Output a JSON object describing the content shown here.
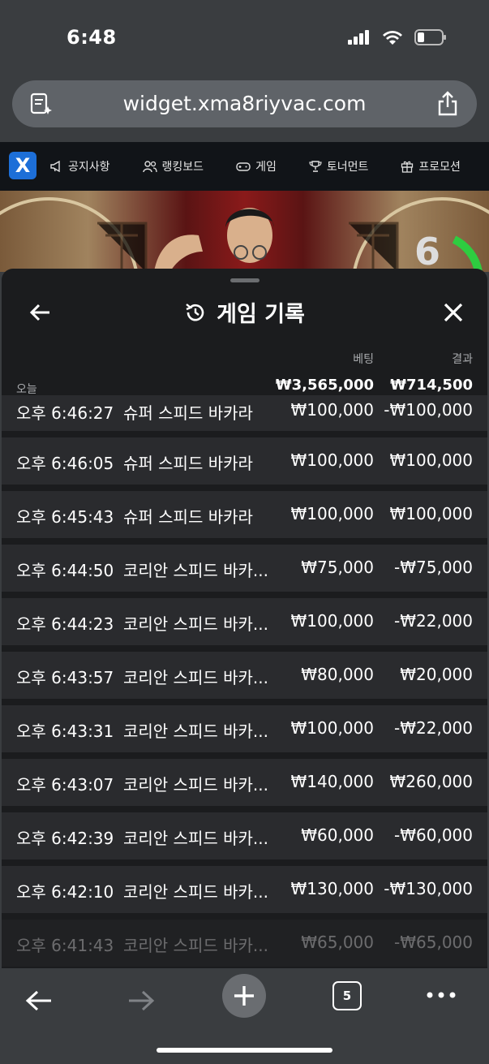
{
  "status_bar": {
    "time": "6:48"
  },
  "browser": {
    "url": "widget.xma8riyvac.com",
    "tab_count": "5"
  },
  "site_nav": {
    "logo": "X",
    "items": [
      {
        "label": "공지사항",
        "icon": "megaphone-icon"
      },
      {
        "label": "랭킹보드",
        "icon": "users-icon"
      },
      {
        "label": "게임",
        "icon": "gamepad-icon"
      },
      {
        "label": "토너먼트",
        "icon": "trophy-icon"
      },
      {
        "label": "프로모션",
        "icon": "gift-icon"
      }
    ]
  },
  "video": {
    "timer": "6"
  },
  "panel": {
    "title": "게임 기록",
    "columns": {
      "bet": "베팅",
      "result": "결과"
    },
    "summary": {
      "label": "오늘",
      "bet": "₩3,565,000",
      "result": "₩714,500"
    },
    "rows": [
      {
        "time": "오후 6:46:27",
        "game": "슈퍼 스피드 바카라",
        "bet": "₩100,000",
        "result": "-₩100,000"
      },
      {
        "time": "오후 6:46:05",
        "game": "슈퍼 스피드 바카라",
        "bet": "₩100,000",
        "result": "₩100,000"
      },
      {
        "time": "오후 6:45:43",
        "game": "슈퍼 스피드 바카라",
        "bet": "₩100,000",
        "result": "₩100,000"
      },
      {
        "time": "오후 6:44:50",
        "game": "코리안 스피드 바카...",
        "bet": "₩75,000",
        "result": "-₩75,000"
      },
      {
        "time": "오후 6:44:23",
        "game": "코리안 스피드 바카...",
        "bet": "₩100,000",
        "result": "-₩22,000"
      },
      {
        "time": "오후 6:43:57",
        "game": "코리안 스피드 바카...",
        "bet": "₩80,000",
        "result": "₩20,000"
      },
      {
        "time": "오후 6:43:31",
        "game": "코리안 스피드 바카...",
        "bet": "₩100,000",
        "result": "-₩22,000"
      },
      {
        "time": "오후 6:43:07",
        "game": "코리안 스피드 바카...",
        "bet": "₩140,000",
        "result": "₩260,000"
      },
      {
        "time": "오후 6:42:39",
        "game": "코리안 스피드 바카...",
        "bet": "₩60,000",
        "result": "-₩60,000"
      },
      {
        "time": "오후 6:42:10",
        "game": "코리안 스피드 바카...",
        "bet": "₩130,000",
        "result": "-₩130,000"
      },
      {
        "time": "오후 6:41:43",
        "game": "코리안 스피드 바카...",
        "bet": "₩65,000",
        "result": "-₩65,000"
      }
    ]
  }
}
